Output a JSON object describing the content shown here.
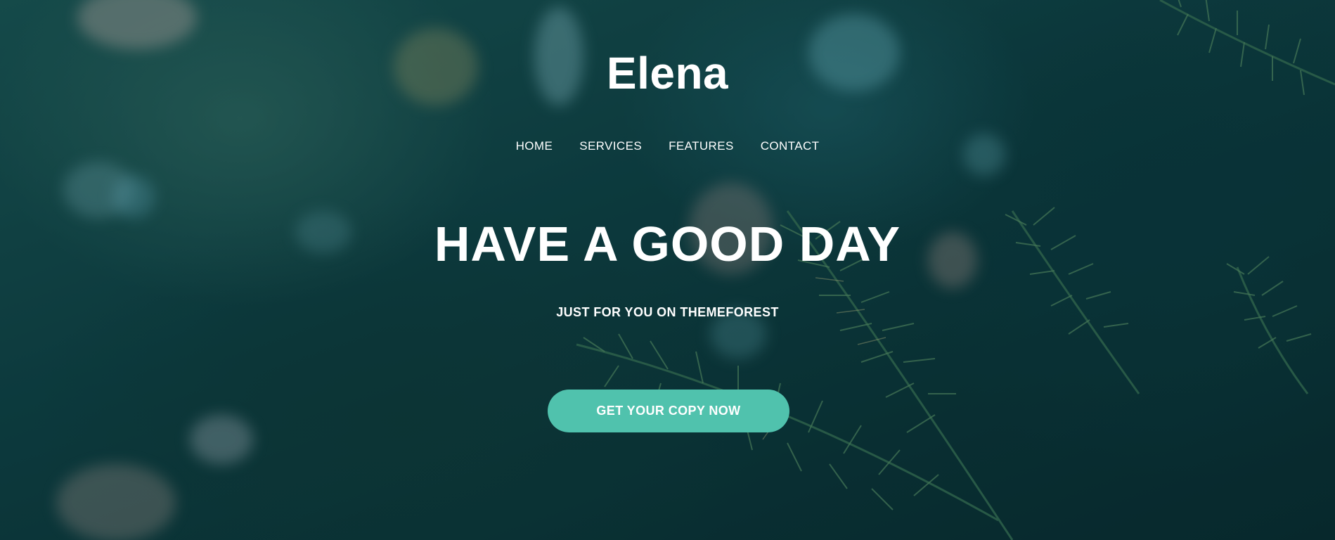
{
  "site": {
    "logo": "Elena"
  },
  "nav": {
    "items": [
      {
        "label": "HOME"
      },
      {
        "label": "SERVICES"
      },
      {
        "label": "FEATURES"
      },
      {
        "label": "CONTACT"
      }
    ]
  },
  "hero": {
    "headline": "HAVE A GOOD DAY",
    "subheadline": "JUST FOR YOU ON THEMEFOREST",
    "cta_label": "GET YOUR COPY NOW",
    "background": "blurred-evergreen-branches-photo"
  },
  "colors": {
    "accent": "#50c2ad",
    "text": "#ffffff",
    "background": "#0f4446"
  }
}
